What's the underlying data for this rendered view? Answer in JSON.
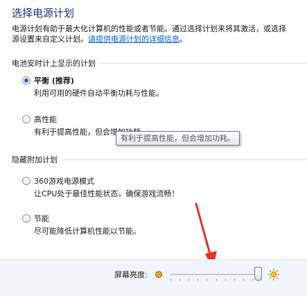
{
  "header": {
    "title": "选择电源计划"
  },
  "intro": {
    "line1": "电源计划有助于最大化计算机的性能或者节能。通过选择计划来将其激活，或选择",
    "line2_prefix": "源设置来自定义计划。",
    "link": "请提供电源计划的详细信息"
  },
  "battery_group": {
    "label": "电池安时计上显示的计划",
    "plans": [
      {
        "name": "平衡 (推荐)",
        "description": "利用可用的硬件自动平衡功耗与性能。",
        "selected": true
      },
      {
        "name": "高性能",
        "description": "有利于提高性能，但会增加功耗。",
        "selected": false
      }
    ]
  },
  "tooltip": {
    "text": "有利于提高性能，但会增加功耗。"
  },
  "hidden_group": {
    "label": "隐藏附加计划",
    "plans": [
      {
        "name": "360游戏电源模式",
        "description": "让CPU处于最佳性能状态，确保游戏流畅！",
        "selected": false
      },
      {
        "name": "节能",
        "description": "尽可能降低计算机性能以节能。",
        "selected": false
      }
    ]
  },
  "brightness": {
    "label": "屏幕亮度:",
    "level_fraction": 0.95
  },
  "colors": {
    "title": "#1e3287",
    "link": "#0066cc",
    "annotation_arrow": "#e8312a",
    "bottom_bar": "#f1f5fb"
  },
  "icons": {
    "dim": "brightness-low-icon",
    "bright": "brightness-high-icon"
  }
}
